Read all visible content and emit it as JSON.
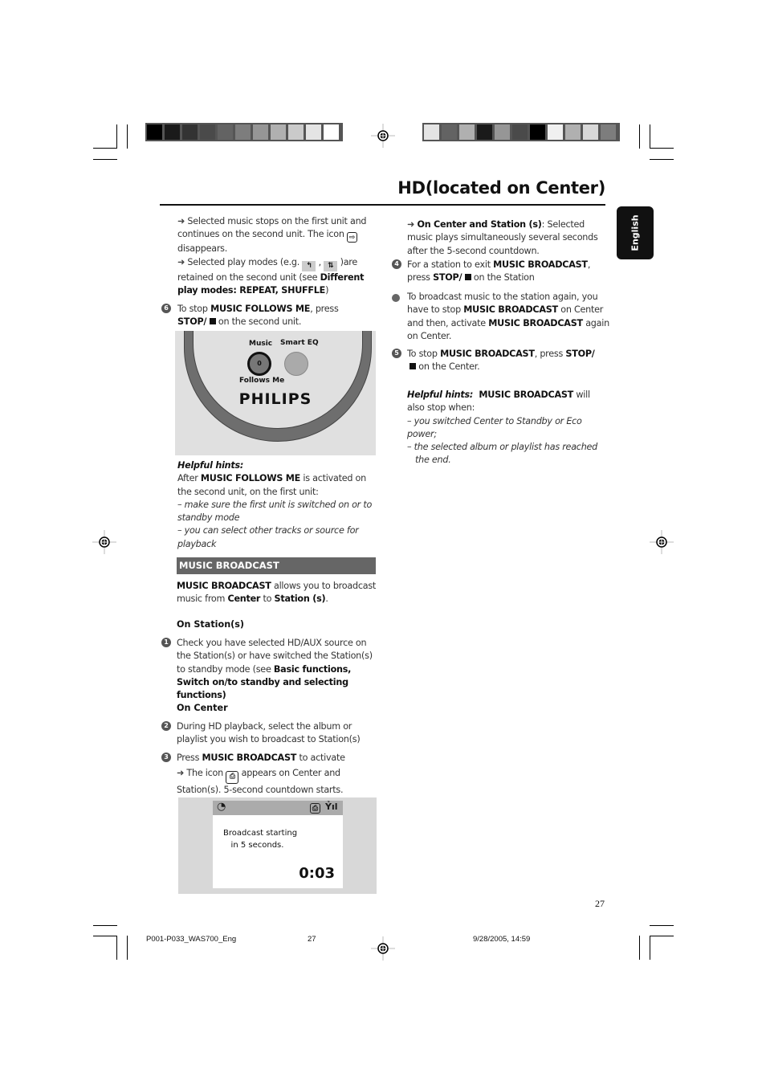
{
  "header": {
    "title": "HD(located on Center)",
    "language_tab": "English",
    "color_bar_left": [
      "#000000",
      "#1a1a1a",
      "#333333",
      "#4a4a4a",
      "#636363",
      "#7d7d7d",
      "#969696",
      "#b0b0b0",
      "#cacaca",
      "#e4e4e4",
      "#ffffff"
    ],
    "color_bar_right": [
      "#e4e4e4",
      "#636363",
      "#b0b0b0",
      "#1a1a1a",
      "#969696",
      "#4a4a4a",
      "#000000",
      "#f0f0f0",
      "#b0b0b0",
      "#d8d8d8",
      "#7d7d7d"
    ]
  },
  "left_column": {
    "p1_arrow": "➜",
    "p1_a": " Selected music stops on the first unit and continues on the second unit.  The icon ",
    "p1_icon": "⇨",
    "p1_b": " disappears.",
    "p2_a": " Selected play modes (e.g. ",
    "p2_icon1": "↰",
    "p2_sep": " ,  ",
    "p2_icon2": "⇅",
    "p2_b": " )are retained on the second unit (see ",
    "p2_bold": "Different play modes: REPEAT, SHUFFLE",
    "p2_c": ")",
    "step6_num": "6",
    "step6_a": "To stop ",
    "step6_bold1": "MUSIC FOLLOWS ME",
    "step6_b": ", press ",
    "step6_bold2": "STOP/",
    "step6_c": " on the second unit.",
    "device": {
      "label_music": "Music",
      "label_smart_eq": "Smart EQ",
      "button_value": "0",
      "label_follows_me": "Follows Me",
      "brand": "PHILIPS"
    },
    "hints_title": "Helpful hints:",
    "hints_a": "After ",
    "hints_bold": "MUSIC FOLLOWS ME",
    "hints_b": " is activated on the second unit,  on the first unit:",
    "hints_item1": "–  make sure the first unit is switched on or to standby mode",
    "hints_item2": "– you can select other tracks or source for playback",
    "section_title": "MUSIC BROADCAST",
    "intro_bold1": "MUSIC BROADCAST",
    "intro_a": " allows you to broadcast music from ",
    "intro_bold2": "Center",
    "intro_b": " to ",
    "intro_bold3": "Station (s)",
    "intro_c": ".",
    "on_station_heading": "On Station(s)",
    "step1_num": "1",
    "step1_a": "Check you have selected HD/AUX source on the Station(s) or have switched the Station(s) to standby mode (see ",
    "step1_bold": "Basic functions, Switch on/to standby and selecting functions)",
    "on_center_heading": "On Center",
    "step2_num": "2",
    "step2_text": "During HD playback,  select the album or playlist you wish to broadcast to Station(s)",
    "step3_num": "3",
    "step3_a": "Press ",
    "step3_bold": "MUSIC BROADCAST",
    "step3_b": " to activate",
    "step3_c": " The icon ",
    "step3_icon": "⎙",
    "step3_d": " appears on Center and Station(s). 5-second countdown starts.",
    "screen": {
      "msg_line1": "Broadcast starting",
      "msg_line2": "   in 5 seconds.",
      "countdown": "0:03",
      "left_icon": "◔",
      "broadcast_icon": "⎙",
      "signal_icon": "Ỷıl"
    }
  },
  "right_column": {
    "p1_bold": "On Center and Station (s)",
    "p1_text": ": Selected music plays simultaneously several seconds after the 5-second countdown.",
    "step4_num": "4",
    "step4_a": "For a station to exit ",
    "step4_bold1": "MUSIC BROADCAST",
    "step4_b": ", press ",
    "step4_bold2": "STOP/",
    "step4_c": "  on the Station",
    "bullet_a": "To broadcast music to the station again, you have to stop ",
    "bullet_bold1": "MUSIC BROADCAST",
    "bullet_b": " on Center and then, activate ",
    "bullet_bold2": "MUSIC BROADCAST",
    "bullet_c": " again on Center.",
    "step5_num": "5",
    "step5_a": "To stop ",
    "step5_bold1": "MUSIC BROADCAST",
    "step5_b": ", press ",
    "step5_bold2": "STOP/",
    "step5_c": "  on the Center.",
    "hints_title": "Helpful hints:",
    "hints_bold": "  MUSIC BROADCAST",
    "hints_a": " will also stop when:",
    "hints_item1": "–  you switched Center to Standby or Eco power;",
    "hints_item2": "–  the selected album or playlist has reached",
    "hints_item2b": "the end."
  },
  "footer": {
    "page_number": "27",
    "file_name": "P001-P033_WAS700_Eng",
    "file_page": "27",
    "timestamp": "9/28/2005, 14:59"
  }
}
